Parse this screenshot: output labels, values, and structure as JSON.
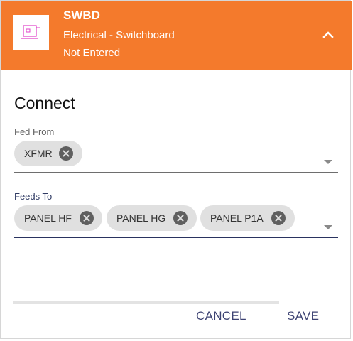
{
  "header": {
    "title": "SWBD",
    "subtitle": "Electrical - Switchboard",
    "status": "Not Entered",
    "accent_color": "#f47a2c",
    "thumbnail_icon": "switchboard-icon",
    "collapse_icon": "chevron-up-icon"
  },
  "section": {
    "title": "Connect"
  },
  "fed_from": {
    "label": "Fed From",
    "chips": [
      {
        "label": "XFMR",
        "remove_icon": "close-circle-icon"
      }
    ],
    "dropdown_icon": "caret-down-icon"
  },
  "feeds_to": {
    "label": "Feeds To",
    "label_color": "#2f3a63",
    "chips": [
      {
        "label": "PANEL HF",
        "remove_icon": "close-circle-icon"
      },
      {
        "label": "PANEL HG",
        "remove_icon": "close-circle-icon"
      },
      {
        "label": "PANEL P1A",
        "remove_icon": "close-circle-icon"
      }
    ],
    "dropdown_icon": "caret-down-icon"
  },
  "actions": {
    "cancel_label": "CANCEL",
    "save_label": "SAVE",
    "button_color": "#3d4373"
  }
}
